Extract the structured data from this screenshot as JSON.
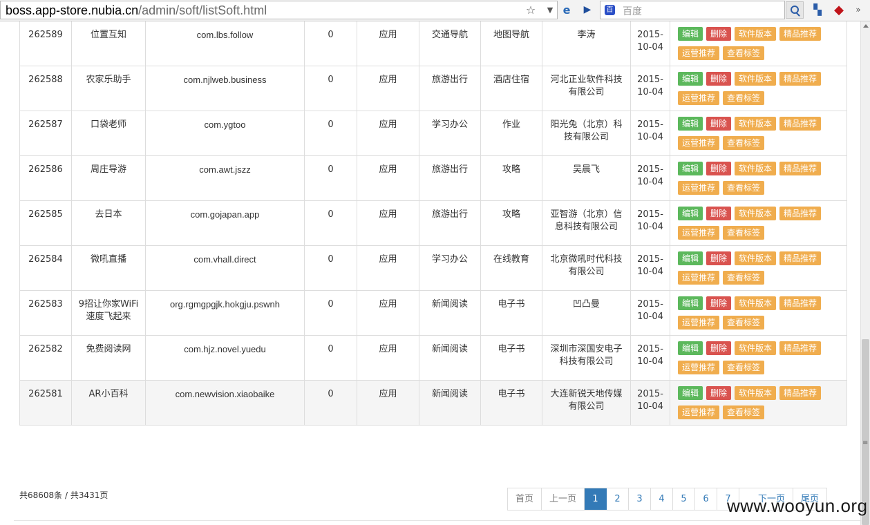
{
  "browser": {
    "url_host": "boss.app-store.nubia.cn",
    "url_path": "/admin/soft/listSoft.html",
    "search_placeholder": "百度",
    "search_engine_glyph": "百"
  },
  "actions": {
    "edit": "编辑",
    "delete": "删除",
    "version": "软件版本",
    "featured": "精品推荐",
    "operation": "运营推荐",
    "tags": "查看标签"
  },
  "rows": [
    {
      "id": "262589",
      "name": "位置互知",
      "pkg": "com.lbs.follow",
      "count": "0",
      "type": "应用",
      "cat": "交通导航",
      "subcat": "地图导航",
      "dev": "李涛",
      "date": "2015-10-04"
    },
    {
      "id": "262588",
      "name": "农家乐助手",
      "pkg": "com.njlweb.business",
      "count": "0",
      "type": "应用",
      "cat": "旅游出行",
      "subcat": "酒店住宿",
      "dev": "河北正业软件科技有限公司",
      "date": "2015-10-04"
    },
    {
      "id": "262587",
      "name": "口袋老师",
      "pkg": "com.ygtoo",
      "count": "0",
      "type": "应用",
      "cat": "学习办公",
      "subcat": "作业",
      "dev": "阳光兔（北京）科技有限公司",
      "date": "2015-10-04"
    },
    {
      "id": "262586",
      "name": "周庄导游",
      "pkg": "com.awt.jszz",
      "count": "0",
      "type": "应用",
      "cat": "旅游出行",
      "subcat": "攻略",
      "dev": "吴晨飞",
      "date": "2015-10-04"
    },
    {
      "id": "262585",
      "name": "去日本",
      "pkg": "com.gojapan.app",
      "count": "0",
      "type": "应用",
      "cat": "旅游出行",
      "subcat": "攻略",
      "dev": "亚智游（北京）信息科技有限公司",
      "date": "2015-10-04"
    },
    {
      "id": "262584",
      "name": "微吼直播",
      "pkg": "com.vhall.direct",
      "count": "0",
      "type": "应用",
      "cat": "学习办公",
      "subcat": "在线教育",
      "dev": "北京微吼时代科技有限公司",
      "date": "2015-10-04"
    },
    {
      "id": "262583",
      "name": "9招让你家WiFi速度飞起来",
      "pkg": "org.rgmgpgjk.hokgju.pswnh",
      "count": "0",
      "type": "应用",
      "cat": "新闻阅读",
      "subcat": "电子书",
      "dev": "凹凸曼",
      "date": "2015-10-04"
    },
    {
      "id": "262582",
      "name": "免费阅读网",
      "pkg": "com.hjz.novel.yuedu",
      "count": "0",
      "type": "应用",
      "cat": "新闻阅读",
      "subcat": "电子书",
      "dev": "深圳市深国安电子科技有限公司",
      "date": "2015-10-04"
    },
    {
      "id": "262581",
      "name": "AR小百科",
      "pkg": "com.newvision.xiaobaike",
      "count": "0",
      "type": "应用",
      "cat": "新闻阅读",
      "subcat": "电子书",
      "dev": "大连新锐天地传媒有限公司",
      "date": "2015-10-04"
    }
  ],
  "summary": "共68608条 / 共3431页",
  "pagination": {
    "first": "首页",
    "prev": "上一页",
    "pages": [
      "1",
      "2",
      "3",
      "4",
      "5",
      "6",
      "7"
    ],
    "current": "1",
    "next": "下一页",
    "last": "尾页"
  },
  "watermark": "www.wooyun.org"
}
